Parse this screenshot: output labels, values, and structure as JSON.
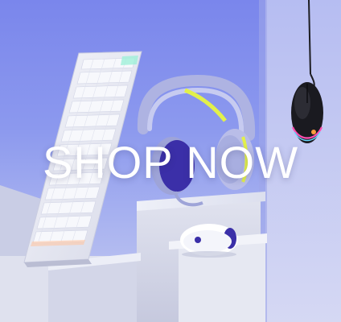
{
  "banner": {
    "cta_label": "SHOP NOW"
  },
  "products": {
    "keyboard": "keyboard",
    "headset": "headset",
    "mouse_white": "mouse",
    "mouse_black": "mouse"
  },
  "colors": {
    "background": "#8c99ee",
    "pedestal_light": "#e9ebf4",
    "pedestal_shade": "#c3c7dc",
    "headset_body": "#b9bde8",
    "headset_cushion": "#3b2fa8",
    "accent_yellow": "#e2f04a",
    "rgb_accent": "#ff4fb0"
  }
}
